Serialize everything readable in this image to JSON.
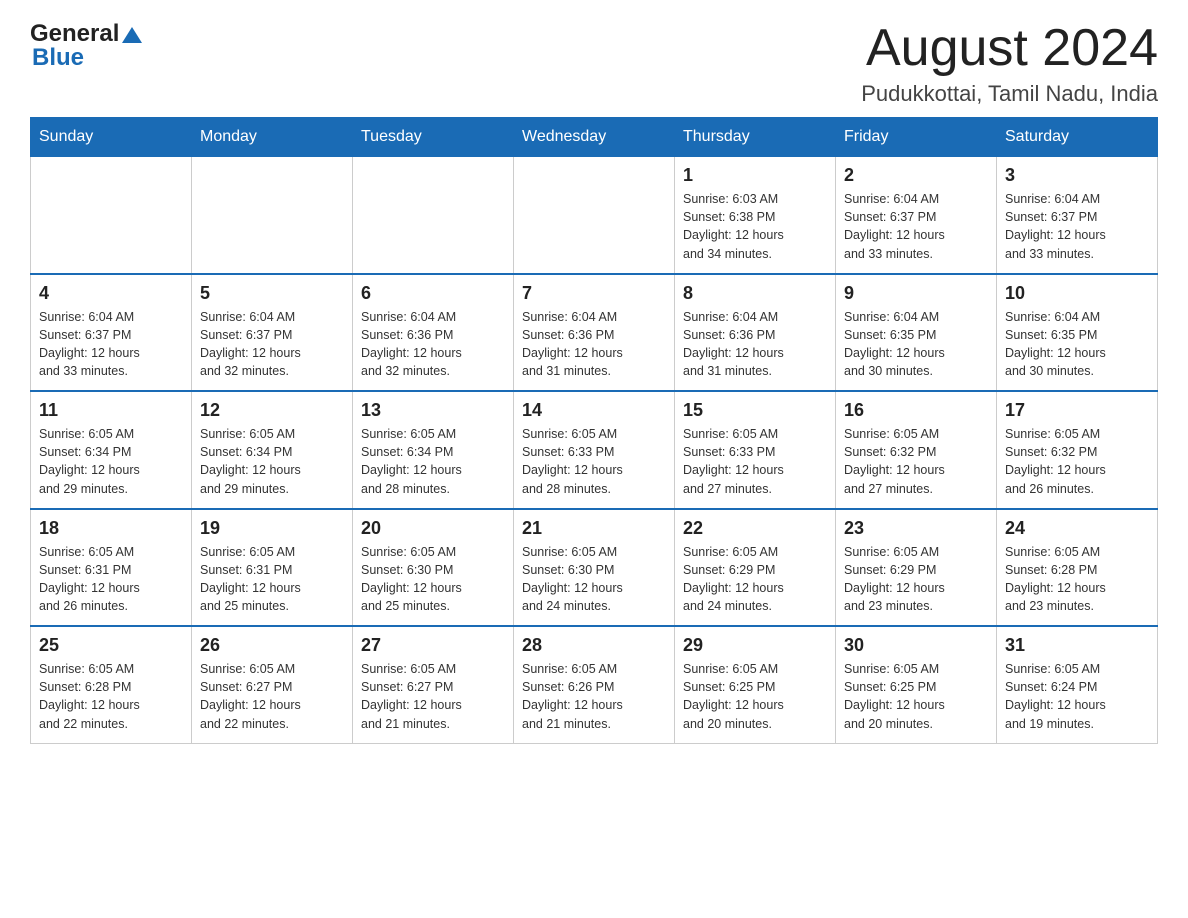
{
  "header": {
    "logo_general": "General",
    "logo_blue": "Blue",
    "month_title": "August 2024",
    "location": "Pudukkottai, Tamil Nadu, India"
  },
  "weekdays": [
    "Sunday",
    "Monday",
    "Tuesday",
    "Wednesday",
    "Thursday",
    "Friday",
    "Saturday"
  ],
  "weeks": [
    [
      {
        "day": "",
        "info": ""
      },
      {
        "day": "",
        "info": ""
      },
      {
        "day": "",
        "info": ""
      },
      {
        "day": "",
        "info": ""
      },
      {
        "day": "1",
        "info": "Sunrise: 6:03 AM\nSunset: 6:38 PM\nDaylight: 12 hours\nand 34 minutes."
      },
      {
        "day": "2",
        "info": "Sunrise: 6:04 AM\nSunset: 6:37 PM\nDaylight: 12 hours\nand 33 minutes."
      },
      {
        "day": "3",
        "info": "Sunrise: 6:04 AM\nSunset: 6:37 PM\nDaylight: 12 hours\nand 33 minutes."
      }
    ],
    [
      {
        "day": "4",
        "info": "Sunrise: 6:04 AM\nSunset: 6:37 PM\nDaylight: 12 hours\nand 33 minutes."
      },
      {
        "day": "5",
        "info": "Sunrise: 6:04 AM\nSunset: 6:37 PM\nDaylight: 12 hours\nand 32 minutes."
      },
      {
        "day": "6",
        "info": "Sunrise: 6:04 AM\nSunset: 6:36 PM\nDaylight: 12 hours\nand 32 minutes."
      },
      {
        "day": "7",
        "info": "Sunrise: 6:04 AM\nSunset: 6:36 PM\nDaylight: 12 hours\nand 31 minutes."
      },
      {
        "day": "8",
        "info": "Sunrise: 6:04 AM\nSunset: 6:36 PM\nDaylight: 12 hours\nand 31 minutes."
      },
      {
        "day": "9",
        "info": "Sunrise: 6:04 AM\nSunset: 6:35 PM\nDaylight: 12 hours\nand 30 minutes."
      },
      {
        "day": "10",
        "info": "Sunrise: 6:04 AM\nSunset: 6:35 PM\nDaylight: 12 hours\nand 30 minutes."
      }
    ],
    [
      {
        "day": "11",
        "info": "Sunrise: 6:05 AM\nSunset: 6:34 PM\nDaylight: 12 hours\nand 29 minutes."
      },
      {
        "day": "12",
        "info": "Sunrise: 6:05 AM\nSunset: 6:34 PM\nDaylight: 12 hours\nand 29 minutes."
      },
      {
        "day": "13",
        "info": "Sunrise: 6:05 AM\nSunset: 6:34 PM\nDaylight: 12 hours\nand 28 minutes."
      },
      {
        "day": "14",
        "info": "Sunrise: 6:05 AM\nSunset: 6:33 PM\nDaylight: 12 hours\nand 28 minutes."
      },
      {
        "day": "15",
        "info": "Sunrise: 6:05 AM\nSunset: 6:33 PM\nDaylight: 12 hours\nand 27 minutes."
      },
      {
        "day": "16",
        "info": "Sunrise: 6:05 AM\nSunset: 6:32 PM\nDaylight: 12 hours\nand 27 minutes."
      },
      {
        "day": "17",
        "info": "Sunrise: 6:05 AM\nSunset: 6:32 PM\nDaylight: 12 hours\nand 26 minutes."
      }
    ],
    [
      {
        "day": "18",
        "info": "Sunrise: 6:05 AM\nSunset: 6:31 PM\nDaylight: 12 hours\nand 26 minutes."
      },
      {
        "day": "19",
        "info": "Sunrise: 6:05 AM\nSunset: 6:31 PM\nDaylight: 12 hours\nand 25 minutes."
      },
      {
        "day": "20",
        "info": "Sunrise: 6:05 AM\nSunset: 6:30 PM\nDaylight: 12 hours\nand 25 minutes."
      },
      {
        "day": "21",
        "info": "Sunrise: 6:05 AM\nSunset: 6:30 PM\nDaylight: 12 hours\nand 24 minutes."
      },
      {
        "day": "22",
        "info": "Sunrise: 6:05 AM\nSunset: 6:29 PM\nDaylight: 12 hours\nand 24 minutes."
      },
      {
        "day": "23",
        "info": "Sunrise: 6:05 AM\nSunset: 6:29 PM\nDaylight: 12 hours\nand 23 minutes."
      },
      {
        "day": "24",
        "info": "Sunrise: 6:05 AM\nSunset: 6:28 PM\nDaylight: 12 hours\nand 23 minutes."
      }
    ],
    [
      {
        "day": "25",
        "info": "Sunrise: 6:05 AM\nSunset: 6:28 PM\nDaylight: 12 hours\nand 22 minutes."
      },
      {
        "day": "26",
        "info": "Sunrise: 6:05 AM\nSunset: 6:27 PM\nDaylight: 12 hours\nand 22 minutes."
      },
      {
        "day": "27",
        "info": "Sunrise: 6:05 AM\nSunset: 6:27 PM\nDaylight: 12 hours\nand 21 minutes."
      },
      {
        "day": "28",
        "info": "Sunrise: 6:05 AM\nSunset: 6:26 PM\nDaylight: 12 hours\nand 21 minutes."
      },
      {
        "day": "29",
        "info": "Sunrise: 6:05 AM\nSunset: 6:25 PM\nDaylight: 12 hours\nand 20 minutes."
      },
      {
        "day": "30",
        "info": "Sunrise: 6:05 AM\nSunset: 6:25 PM\nDaylight: 12 hours\nand 20 minutes."
      },
      {
        "day": "31",
        "info": "Sunrise: 6:05 AM\nSunset: 6:24 PM\nDaylight: 12 hours\nand 19 minutes."
      }
    ]
  ]
}
